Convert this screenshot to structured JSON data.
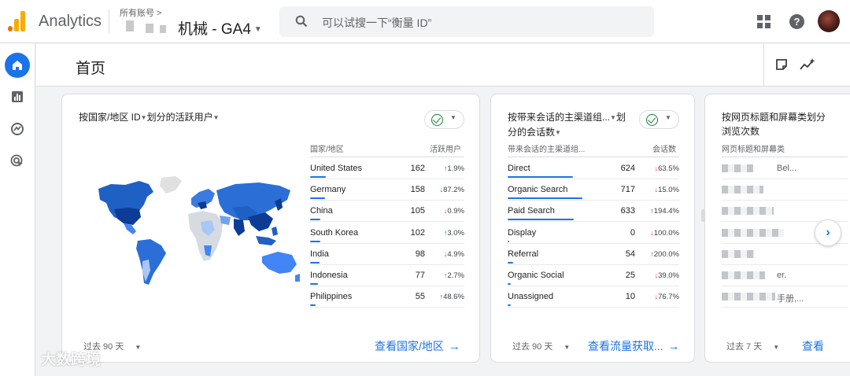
{
  "header": {
    "app_name": "Analytics",
    "account_label": "所有账号 > ",
    "property_name": "机械 - GA4",
    "search_placeholder": "可以试搜一下“衡量 ID”"
  },
  "page": {
    "title": "首页"
  },
  "cards": [
    {
      "title": "按国家/地区 ID",
      "title_suffix": "划分的活跃用户",
      "col_dim": "国家/地区",
      "col_metric": "活跃用户",
      "rows": [
        {
          "label": "United States",
          "value": "162",
          "dir": "up",
          "delta": "1.9%",
          "bar": 1.0
        },
        {
          "label": "Germany",
          "value": "158",
          "dir": "down",
          "delta": "87.2%",
          "bar": 0.97
        },
        {
          "label": "China",
          "value": "105",
          "dir": "down",
          "delta": "0.9%",
          "bar": 0.65
        },
        {
          "label": "South Korea",
          "value": "102",
          "dir": "up",
          "delta": "3.0%",
          "bar": 0.63
        },
        {
          "label": "India",
          "value": "98",
          "dir": "down",
          "delta": "4.9%",
          "bar": 0.6
        },
        {
          "label": "Indonesia",
          "value": "77",
          "dir": "up",
          "delta": "2.7%",
          "bar": 0.48
        },
        {
          "label": "Philippines",
          "value": "55",
          "dir": "up",
          "delta": "48.6%",
          "bar": 0.34
        }
      ],
      "range": "过去 90 天",
      "link": "查看国家/地区"
    },
    {
      "title": "按带来会话的主渠道组...",
      "title_suffix": "划",
      "title_line2": "分的会话数",
      "col_dim": "带来会话的主渠道组...",
      "col_metric": "会话数",
      "rows": [
        {
          "label": "Direct",
          "value": "624",
          "dir": "down",
          "delta": "63.5%",
          "bar": 0.87
        },
        {
          "label": "Organic Search",
          "value": "717",
          "dir": "down",
          "delta": "15.0%",
          "bar": 1.0
        },
        {
          "label": "Paid Search",
          "value": "633",
          "dir": "up",
          "delta": "194.4%",
          "bar": 0.88
        },
        {
          "label": "Display",
          "value": "0",
          "dir": "down",
          "delta": "100.0%",
          "bar": 0.0
        },
        {
          "label": "Referral",
          "value": "54",
          "dir": "up",
          "delta": "200.0%",
          "bar": 0.075
        },
        {
          "label": "Organic Social",
          "value": "25",
          "dir": "down",
          "delta": "39.0%",
          "bar": 0.035
        },
        {
          "label": "Unassigned",
          "value": "10",
          "dir": "down",
          "delta": "76.7%",
          "bar": 0.014
        }
      ],
      "range": "过去 90 天",
      "link": "查看流量获取..."
    },
    {
      "title": "按网页标题和屏幕类划分",
      "title_line2": "浏览次数",
      "col_dim": "网页标题和屏幕类",
      "rows": [
        {
          "label": "Bel..."
        },
        {
          "label": ""
        },
        {
          "label": ""
        },
        {
          "label": ""
        },
        {
          "label": ""
        },
        {
          "label": "er."
        },
        {
          "label": "手册,..."
        }
      ],
      "range": "过去 7 天",
      "link": "查看"
    }
  ],
  "icons": {
    "search": "search-icon",
    "apps": "apps-grid-icon",
    "help": "help-icon",
    "home": "home-icon",
    "reports": "reports-icon",
    "explore": "explore-icon",
    "advertising": "advertising-icon",
    "insights_card": "customize-icon",
    "insights": "insights-icon",
    "next": "chevron-right-icon"
  },
  "colors": {
    "accent": "#1a73e8",
    "up": "#188038",
    "down": "#d93025"
  },
  "watermark": "大数跨境"
}
